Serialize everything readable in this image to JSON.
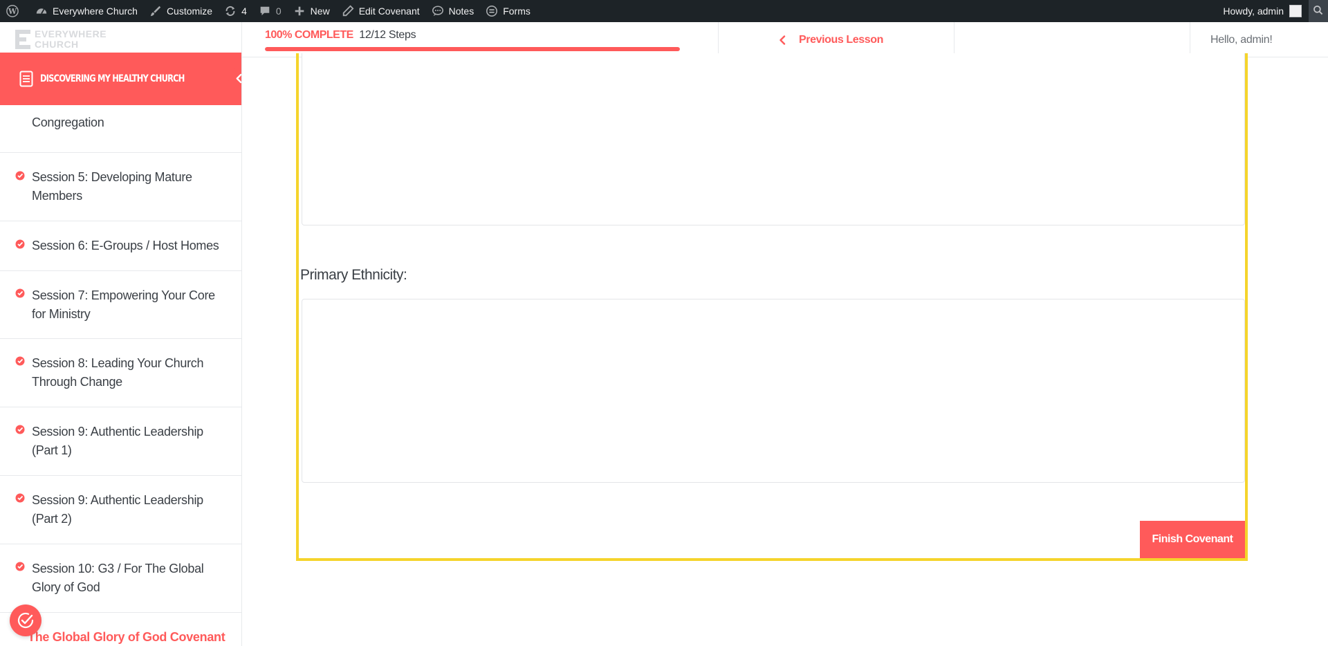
{
  "adminbar": {
    "wp_logo_icon": "wordpress-icon",
    "site_name": "Everywhere Church",
    "customize": "Customize",
    "updates_count": "4",
    "comments_count": "0",
    "new": "New",
    "edit": "Edit Covenant",
    "notes": "Notes",
    "forms": "Forms",
    "howdy": "Howdy, admin"
  },
  "sidebar": {
    "logo_line1": "EVERYWHERE",
    "logo_line2": "CHURCH",
    "course_title": "Discovering My Healthy Church",
    "lessons": [
      {
        "label": "Congregation"
      },
      {
        "label": "Session 5: Developing Mature Members"
      },
      {
        "label": "Session 6: E-Groups / Host Homes"
      },
      {
        "label": "Session 7: Empowering Your Core for Ministry"
      },
      {
        "label": "Session 8: Leading Your Church Through Change"
      },
      {
        "label": "Session 9: Authentic Leadership (Part 1)"
      },
      {
        "label": "Session 9: Authentic Leadership (Part 2)"
      },
      {
        "label": "Session 10: G3 / For The Global Glory of God"
      },
      {
        "label": "The Global Glory of God Covenant"
      }
    ]
  },
  "topbar": {
    "progress_label": "100% COMPLETE",
    "steps_label": "12/12 Steps",
    "progress_fraction": 1.0,
    "previous_lesson": "Previous Lesson",
    "hello": "Hello, admin!"
  },
  "form": {
    "field_label": "Primary Ethnicity:",
    "finish_button": "Finish Covenant"
  },
  "colors": {
    "accent": "#ff5a5a",
    "frame": "#f5d42c",
    "adminbar": "#1d2327"
  }
}
